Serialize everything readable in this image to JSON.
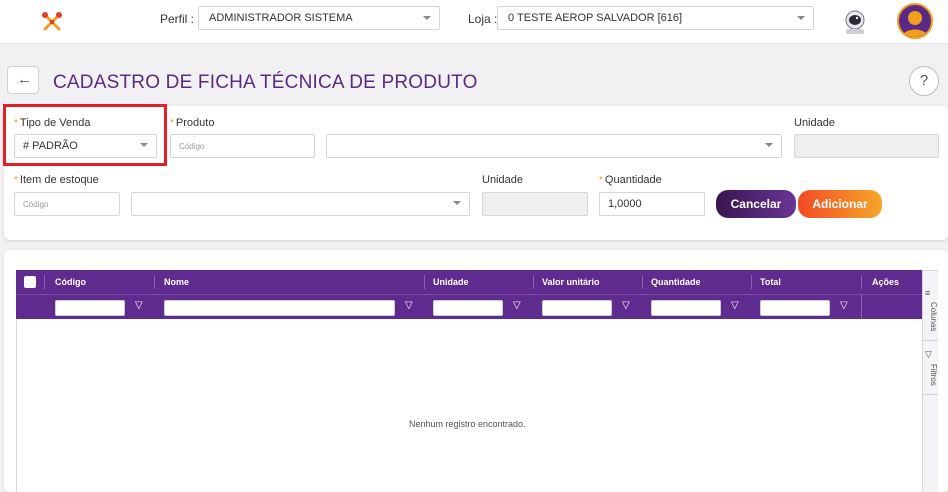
{
  "topbar": {
    "perfil_label": "Perfil :",
    "perfil_value": "ADMINISTRADOR SISTEMA",
    "loja_label": "Loja :",
    "loja_value": "0 TESTE AEROP SALVADOR [616]"
  },
  "title": {
    "back": "←",
    "text": "CADASTRO DE FICHA TÉCNICA DE PRODUTO",
    "help": "?"
  },
  "form": {
    "tipo_venda_label": "Tipo de Venda",
    "tipo_venda_value": "# PADRÃO",
    "produto_label": "Produto",
    "produto_codigo_placeholder": "Código",
    "unidade_label": "Unidade",
    "item_estoque_label": "Item de estoque",
    "item_codigo_placeholder": "Código",
    "item_unidade_label": "Unidade",
    "quantidade_label": "Quantidade",
    "quantidade_value": "1,0000",
    "required_mark": "*",
    "cancel_label": "Cancelar",
    "add_label": "Adicionar"
  },
  "grid": {
    "columns": [
      "Código",
      "Nome",
      "Unidade",
      "Valor unitário",
      "Quantidade",
      "Total",
      "Ações"
    ],
    "filter_symbol": "▽",
    "empty_message": "Nenhum registro encontrado.",
    "side_tabs": [
      "Colunas",
      "Filtros"
    ]
  },
  "colors": {
    "brand_purple": "#5f2b8f",
    "accent_orange": "#f6a62a",
    "highlight_red": "#e3202a"
  }
}
